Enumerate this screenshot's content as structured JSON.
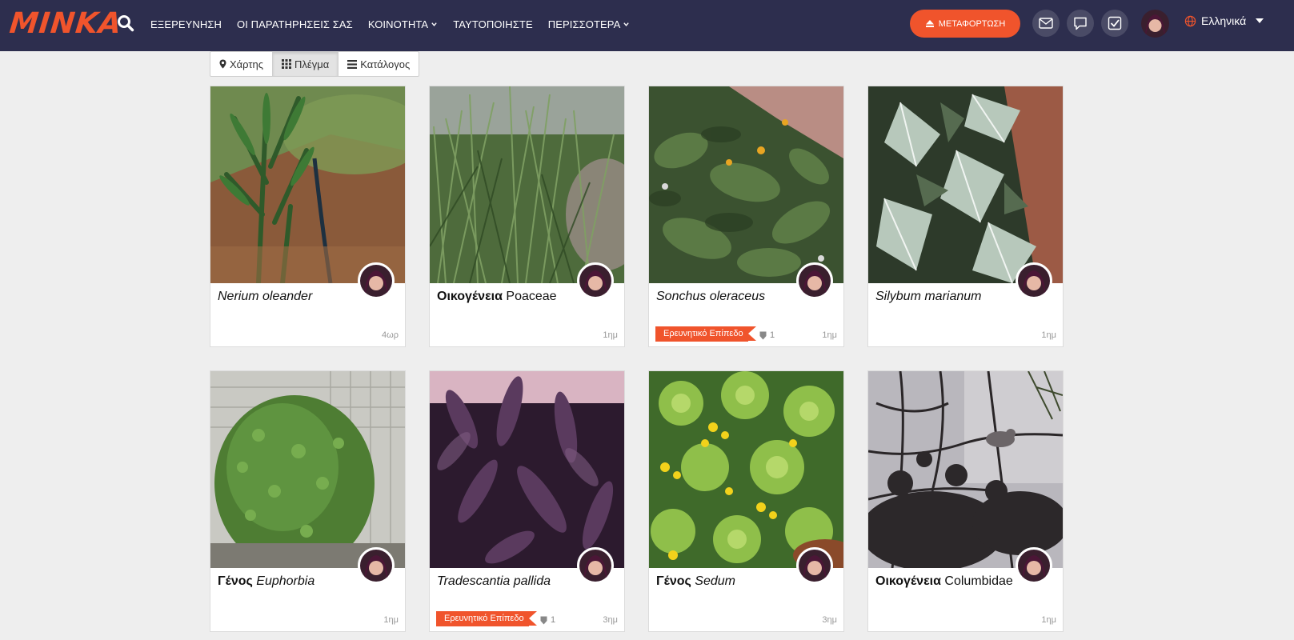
{
  "header": {
    "logo_text": "MINKA",
    "nav": [
      {
        "label": "ΕΞΕΡΕΥΝΗΣΗ",
        "dropdown": false
      },
      {
        "label": "ΟΙ ΠΑΡΑΤΗΡΗΣΕΙΣ ΣΑΣ",
        "dropdown": false
      },
      {
        "label": "ΚΟΙΝΟΤΗΤΑ",
        "dropdown": true
      },
      {
        "label": "ΤΑΥΤΟΠΟΙΗΣΤΕ",
        "dropdown": false
      },
      {
        "label": "ΠΕΡΙΣΣΟΤΕΡΑ",
        "dropdown": true
      }
    ],
    "upload_label": "ΜΕΤΑΦΟΡΤΩΣΗ",
    "icons": [
      "search-icon",
      "upload-icon",
      "mail-icon",
      "chat-icon",
      "check-icon",
      "globe-icon"
    ],
    "language": "Ελληνικά"
  },
  "view_toggle": {
    "map": "Χάρτης",
    "grid": "Πλέγμα",
    "list": "Κατάλογος",
    "active": "grid"
  },
  "colors": {
    "header_bg": "#2d2e4e",
    "accent": "#f0542c",
    "page_bg": "#eeeeee"
  },
  "observations": [
    {
      "rank": "",
      "taxon": "Nerium oleander",
      "italic": true,
      "age": "4ωρ",
      "badge": "",
      "ids": ""
    },
    {
      "rank": "Οικογένεια",
      "taxon": "Poaceae",
      "italic": false,
      "age": "1ημ",
      "badge": "",
      "ids": ""
    },
    {
      "rank": "",
      "taxon": "Sonchus oleraceus",
      "italic": true,
      "age": "1ημ",
      "badge": "Ερευνητικό Επίπεδο",
      "ids": "1"
    },
    {
      "rank": "",
      "taxon": "Silybum marianum",
      "italic": true,
      "age": "1ημ",
      "badge": "",
      "ids": ""
    },
    {
      "rank": "Γένος",
      "taxon": "Euphorbia",
      "italic": true,
      "age": "1ημ",
      "badge": "",
      "ids": ""
    },
    {
      "rank": "",
      "taxon": "Tradescantia pallida",
      "italic": true,
      "age": "3ημ",
      "badge": "Ερευνητικό Επίπεδο",
      "ids": "1"
    },
    {
      "rank": "Γένος",
      "taxon": "Sedum",
      "italic": true,
      "age": "3ημ",
      "badge": "",
      "ids": ""
    },
    {
      "rank": "Οικογένεια",
      "taxon": "Columbidae",
      "italic": false,
      "age": "1ημ",
      "badge": "",
      "ids": ""
    }
  ]
}
